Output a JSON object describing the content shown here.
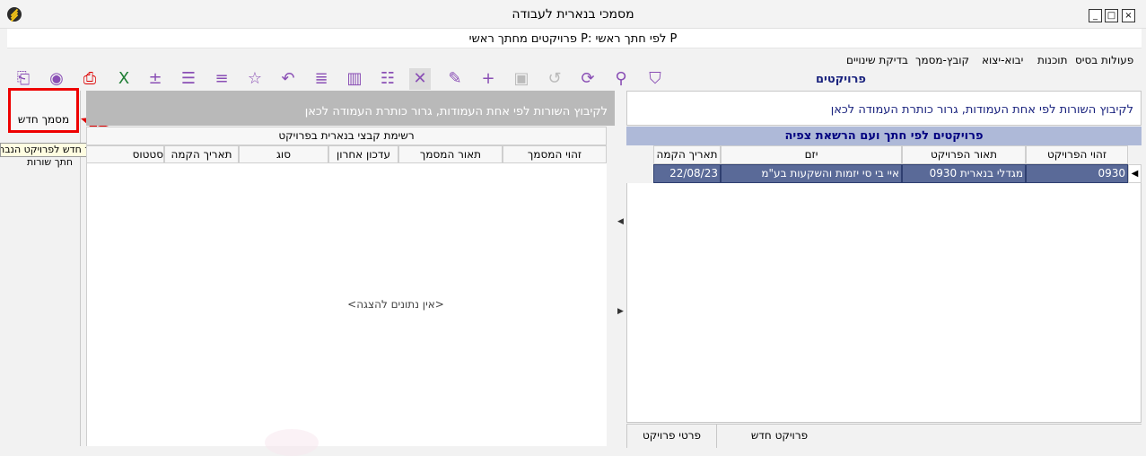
{
  "window": {
    "title": "מסמכי בנארית לעבודה",
    "subtitle": "פרויקטים מחתך ראשי P: לפי חתך ראשי P",
    "controls": [
      "_",
      "□",
      "×"
    ]
  },
  "menu": [
    "פעולות בסיס",
    "תוכנות",
    "יבוא-יצוא",
    "קובץ-מסמך",
    "בדיקת שינויים"
  ],
  "projects_title": "פרויקטים",
  "toolbar_icons": [
    "filter-icon",
    "search-icon",
    "refresh-icon",
    "undo-icon",
    "save-icon",
    "add-icon",
    "edit-icon",
    "tools-icon",
    "list-icon",
    "columns-icon",
    "rows-icon",
    "back-icon",
    "favorite-icon",
    "insert-after-icon",
    "lines-icon",
    "insert-icon",
    "excel-icon",
    "pdf-icon",
    "view-icon",
    "print-icon"
  ],
  "left_strip": {
    "new_doc_button": "מסמך חדש",
    "tooltip": "הגדרת מסמך חדש לפרויקט הנבחר",
    "insert_rows": "חתך שורות"
  },
  "middle": {
    "group_hint": "לקיבוץ השורות לפי אחת העמודות, גרור כותרת העמודה לכאן",
    "caption": "רשימת קבצי בנארית בפרויקט",
    "columns": [
      "זהוי המסמך",
      "תאור המסמך",
      "עדכון אחרון",
      "סוג",
      "תאריך הקמה",
      "סטטוס"
    ],
    "no_data": "<אין נתונים להצגה>"
  },
  "right": {
    "group_hint": "לקיבוץ השורות לפי אחת העמודות, גרור כותרת העמודה לכאן",
    "group_bar": "פרויקטים לפי חתך ועם הרשאת צפיה",
    "columns": [
      "זהוי הפרויקט",
      "תאור הפרויקט",
      "יזם",
      "תאריך הקמה"
    ],
    "rows": [
      {
        "id": "0930",
        "desc": "מגדלי בנארית 0930",
        "developer": "איי בי סי יזמות והשקעות בע\"מ",
        "date": "22/08/23"
      }
    ]
  },
  "bottom_tabs": [
    "פרויקט חדש",
    "פרטי פרויקט"
  ],
  "colors": {
    "accent": "#1a237e",
    "selection": "#5a6a98",
    "highlight": "#e00000"
  }
}
